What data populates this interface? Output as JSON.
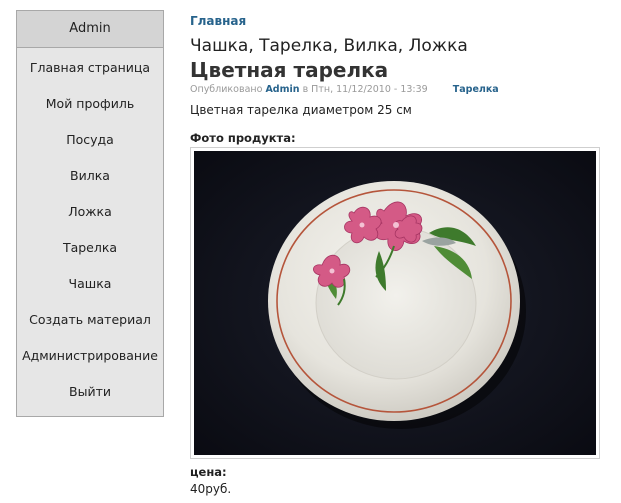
{
  "sidebar": {
    "header": "Admin",
    "items": [
      {
        "label": "Главная страница"
      },
      {
        "label": "Мой профиль"
      },
      {
        "label": "Посуда"
      },
      {
        "label": "Вилка"
      },
      {
        "label": "Ложка"
      },
      {
        "label": "Тарелка"
      },
      {
        "label": "Чашка"
      },
      {
        "label": "Создать материал"
      },
      {
        "label": "Администрирование"
      },
      {
        "label": "Выйти"
      }
    ]
  },
  "main": {
    "breadcrumb": "Главная",
    "category_title": "Чашка, Тарелка, Вилка, Ложка",
    "node_title": "Цветная тарелка",
    "submitted": {
      "prefix": "Опубликовано",
      "author": "Admin",
      "date_text": "в Птн, 11/12/2010 - 13:39",
      "tag": "Тарелка"
    },
    "body": "Цветная тарелка диаметром 25 см",
    "photo_label": "Фото продукта:",
    "photo_subject": "plate-with-floral-pattern",
    "price_label": "цена:",
    "price_value": "40руб."
  },
  "colors": {
    "link": "#27638c",
    "sidebar_bg": "#e6e6e6",
    "sidebar_header_bg": "#d4d4d4",
    "photo_bg": "#11131c"
  }
}
